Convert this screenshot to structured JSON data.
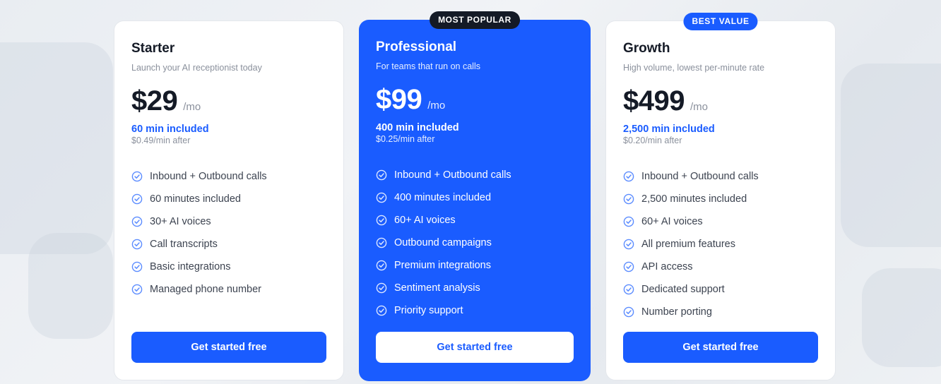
{
  "colors": {
    "accent": "#1a5cff",
    "text_dark": "#141a26",
    "text_muted": "#8a909c",
    "badge_dark": "#141a26"
  },
  "plans": [
    {
      "name": "Starter",
      "subtitle": "Launch your AI receptionist today",
      "price": "$29",
      "per": "/mo",
      "included": "60 min included",
      "after": "$0.49/min after",
      "features": [
        "Inbound + Outbound calls",
        "60 minutes included",
        "30+ AI voices",
        "Call transcripts",
        "Basic integrations",
        "Managed phone number"
      ],
      "cta": "Get started free"
    },
    {
      "badge": "MOST POPULAR",
      "name": "Professional",
      "subtitle": "For teams that run on calls",
      "price": "$99",
      "per": "/mo",
      "included": "400 min included",
      "after": "$0.25/min after",
      "features": [
        "Inbound + Outbound calls",
        "400 minutes included",
        "60+ AI voices",
        "Outbound campaigns",
        "Premium integrations",
        "Sentiment analysis",
        "Priority support"
      ],
      "cta": "Get started free"
    },
    {
      "badge": "BEST VALUE",
      "name": "Growth",
      "subtitle": "High volume, lowest per-minute rate",
      "price": "$499",
      "per": "/mo",
      "included": "2,500 min included",
      "after": "$0.20/min after",
      "features": [
        "Inbound + Outbound calls",
        "2,500 minutes included",
        "60+ AI voices",
        "All premium features",
        "API access",
        "Dedicated support",
        "Number porting"
      ],
      "cta": "Get started free"
    }
  ],
  "icons": {
    "feature_check": "check-circle-icon"
  }
}
